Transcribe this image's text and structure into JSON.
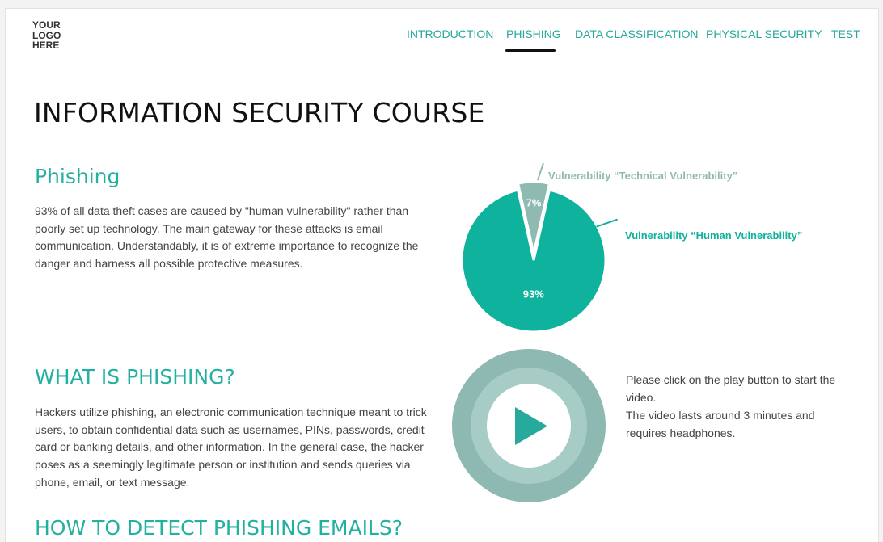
{
  "header": {
    "logo_lines": [
      "YOUR",
      "LOGO",
      "HERE"
    ],
    "nav": [
      {
        "label": "INTRODUCTION",
        "active": false
      },
      {
        "label": "PHISHING",
        "active": true
      },
      {
        "label": "DATA CLASSIFICATION",
        "active": false
      },
      {
        "label": "PHYSICAL SECURITY",
        "active": false
      },
      {
        "label": "TEST",
        "active": false
      }
    ]
  },
  "page": {
    "title": "INFORMATION SECURITY COURSE"
  },
  "phishing": {
    "heading": "Phishing",
    "body": "93% of all data theft cases are caused by \"human vulnerability\" rather than poorly set up technology. The main gateway for these attacks is email communication. Understandably, it is of extreme importance to recognize the danger and harness all possible protective measures."
  },
  "chart_data": {
    "type": "pie",
    "title": "",
    "slices": [
      {
        "label": "Vulnerability “Technical Vulnerability”",
        "value": 7,
        "value_label": "7%",
        "color": "#8fbab2",
        "exploded": true
      },
      {
        "label": "Vulnerability “Human Vulnerability”",
        "value": 93,
        "value_label": "93%",
        "color": "#0fb29c",
        "exploded": false
      }
    ],
    "legend": "callout labels"
  },
  "what_is": {
    "heading": "WHAT IS PHISHING?",
    "body": "Hackers utilize phishing, an electronic communication technique meant to trick users, to obtain confidential data such as usernames, PINs, passwords, credit card or banking details, and other information. In the general case, the hacker poses as a seemingly legitimate person or institution and sends queries via phone, email, or text message."
  },
  "video": {
    "icon": "play-icon",
    "note_line1": "Please click on the play button to start the video.",
    "note_line2": "The video lasts around 3 minutes and requires headphones.",
    "colors": {
      "outer": "#8db9b2",
      "inner": "#a7ccc6",
      "center": "#ffffff",
      "play": "#27a99b"
    }
  },
  "detect": {
    "heading": "HOW TO DETECT PHISHING EMAILS?"
  },
  "colors": {
    "accent": "#22b0a0",
    "nav_text": "#25a89b",
    "title_text": "#111111",
    "body_text": "#444444"
  }
}
